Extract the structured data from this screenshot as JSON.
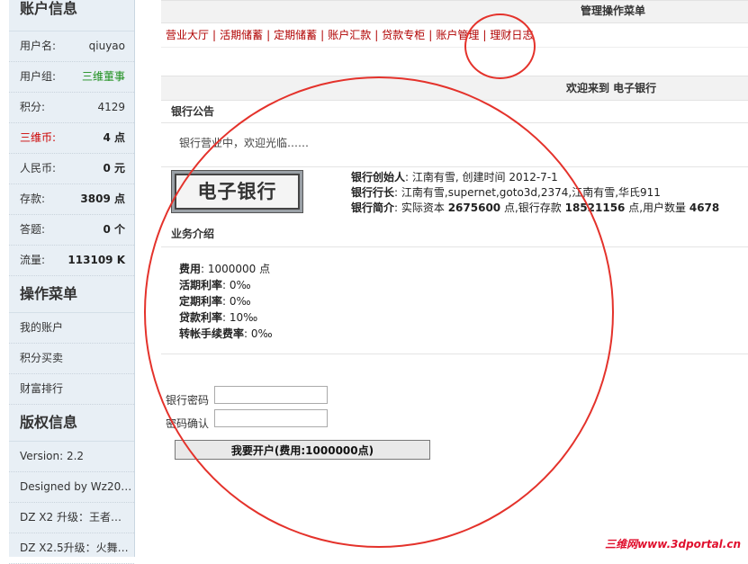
{
  "sidebar": {
    "account_title": "账户信息",
    "account_rows": [
      {
        "label": "用户名:",
        "value": "qiuyao"
      },
      {
        "label": "用户组:",
        "value": "三维董事"
      },
      {
        "label": "积分:",
        "value": "4129"
      },
      {
        "label": "三维币:",
        "value": "4 点"
      },
      {
        "label": "人民币:",
        "value": "0 元"
      },
      {
        "label": "存款:",
        "value": "3809 点"
      },
      {
        "label": "答题:",
        "value": "0 个"
      },
      {
        "label": "流量:",
        "value": "113109 K"
      }
    ],
    "menu_title": "操作菜单",
    "menu_items": [
      "我的账户",
      "积分买卖",
      "财富排行"
    ],
    "copyright_title": "版权信息",
    "copyright_rows": [
      "Version: 2.2",
      "Designed by Wz20…",
      "DZ X2 升级：王者…",
      "DZ X2.5升级：火舞…"
    ]
  },
  "main": {
    "topmenu_title": "管理操作菜单",
    "nav": [
      "营业大厅",
      "活期储蓄",
      "定期储蓄",
      "账户汇款",
      "贷款专柜",
      "账户管理",
      "理财日志"
    ],
    "welcome": "欢迎来到  电子银行",
    "notice_title": "银行公告",
    "notice_text": "银行营业中，欢迎光临……",
    "logo_text": "电子银行",
    "info": {
      "founder_label": "银行创始人",
      "founder_value": ": 江南有雪, 创建时间  2012-7-1",
      "president_label": "银行行长",
      "president_value": ": 江南有雪,supernet,goto3d,2374,江南有雪,华氏911",
      "brief_label": "银行简介",
      "brief_p1": ": 实际资本 ",
      "capital": "2675600",
      "brief_p2": " 点,银行存款 ",
      "deposit": "18521156",
      "brief_p3": " 点,用户数量 ",
      "users": "4678"
    },
    "biz_title": "业务介绍",
    "biz": [
      {
        "label": "费用",
        "value": ": 1000000 点"
      },
      {
        "label": "活期利率",
        "value": ": 0‰"
      },
      {
        "label": "定期利率",
        "value": ": 0‰"
      },
      {
        "label": "贷款利率",
        "value": ": 10‰"
      },
      {
        "label": "转帐手续费率",
        "value": ": 0‰"
      }
    ],
    "pwd_label": "银行密码",
    "pwd2_label": "密码确认",
    "open_button": "我要开户(费用:1000000点)"
  },
  "watermark": "三维网www.3dportal.cn",
  "colors": {
    "nav": "#b00000",
    "annotation": "#e4322b",
    "sidebar_bg": "#e8eff5"
  }
}
